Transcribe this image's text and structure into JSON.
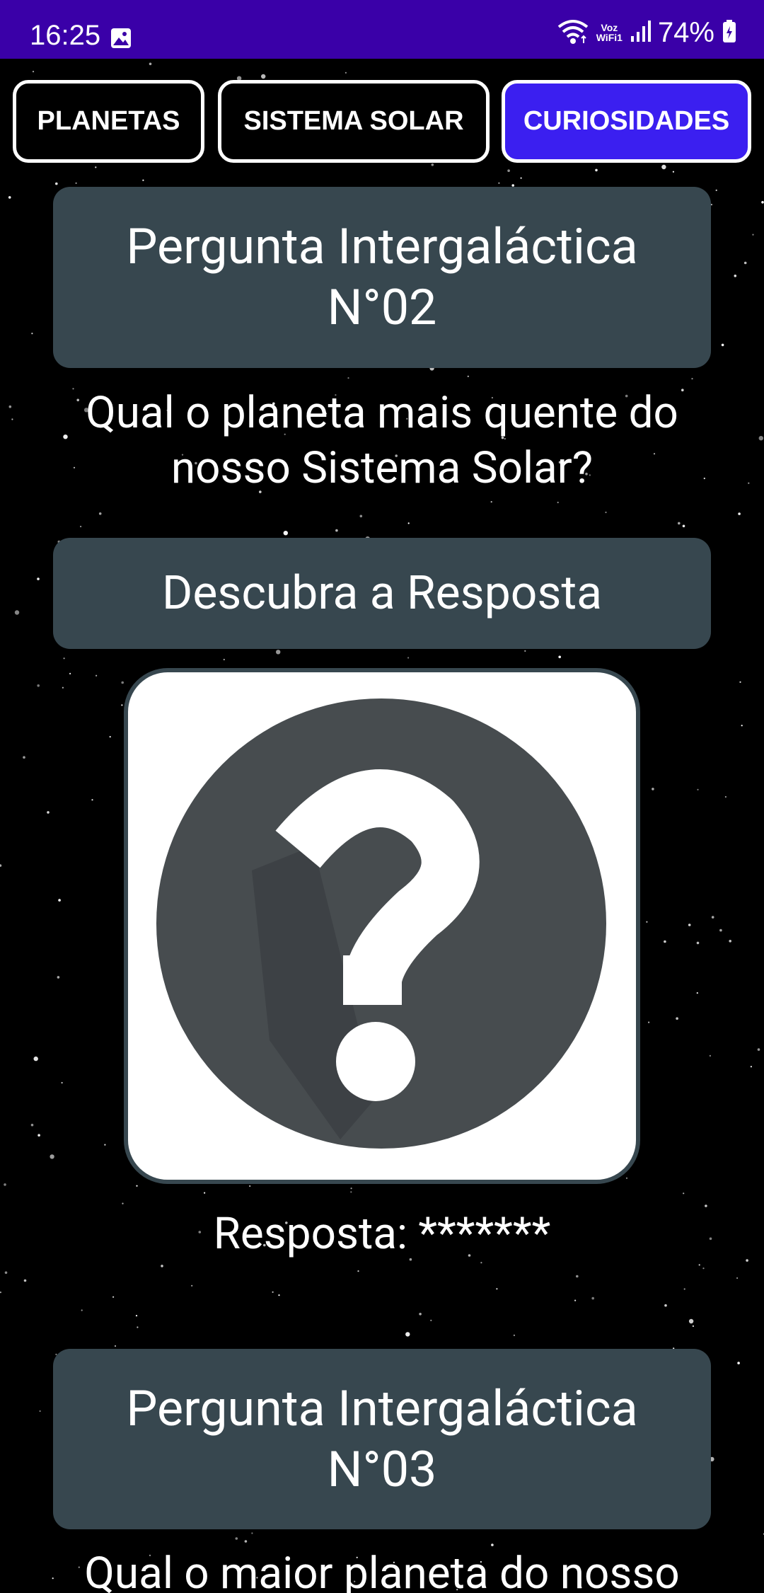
{
  "status_bar": {
    "time": "16:25",
    "volte_top": "Voz",
    "volte_bottom": "WiFi1",
    "battery": "74%",
    "icons": [
      "gallery-icon",
      "wifi-icon",
      "signal-icon",
      "battery-icon"
    ]
  },
  "tabs": [
    {
      "label": "PLANETAS",
      "active": false
    },
    {
      "label": "SISTEMA SOLAR",
      "active": false
    },
    {
      "label": "CURIOSIDADES",
      "active": true
    }
  ],
  "colors": {
    "status_bar": "#3a00a8",
    "tab_active": "#3b1ff0",
    "panel": "#37474f",
    "question_circle": "#474c4f"
  },
  "questions": [
    {
      "title_line1": "Pergunta Intergaláctica",
      "title_line2": "N°02",
      "text_line1": "Qual o planeta mais quente do",
      "text_line2": "nosso Sistema Solar?",
      "reveal_label": "Descubra a Resposta",
      "image_icon": "question-mark-icon",
      "answer": "Resposta: *******"
    },
    {
      "title_line1": "Pergunta Intergaláctica",
      "title_line2": "N°03",
      "text_line1": "Qual o maior planeta do nosso"
    }
  ]
}
